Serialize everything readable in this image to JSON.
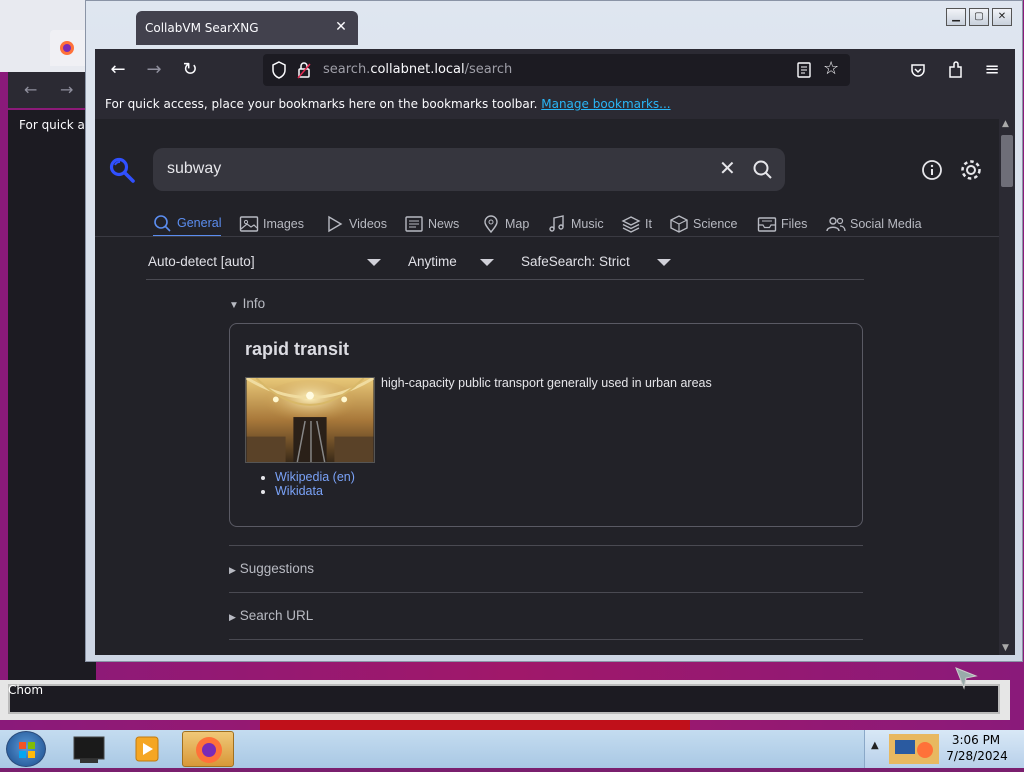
{
  "background_window": {
    "bookmark_hint": "For quick ac",
    "taskbar_label": "Chom"
  },
  "window": {
    "tab_title": "CollabVM SearXNG",
    "tab_close": "✕",
    "url_domain_prefix": "search.",
    "url_domain": "collabnet.local",
    "url_path": "/search",
    "bookmarks_text": "For quick access, place your bookmarks here on the bookmarks toolbar.",
    "bookmarks_link": "Manage bookmarks..."
  },
  "search": {
    "query": "subway"
  },
  "categories": [
    {
      "label": "General",
      "icon": "search-icon",
      "active": true
    },
    {
      "label": "Images",
      "icon": "image-icon"
    },
    {
      "label": "Videos",
      "icon": "play-icon"
    },
    {
      "label": "News",
      "icon": "newspaper-icon"
    },
    {
      "label": "Map",
      "icon": "map-pin-icon"
    },
    {
      "label": "Music",
      "icon": "music-icon"
    },
    {
      "label": "It",
      "icon": "layers-icon"
    },
    {
      "label": "Science",
      "icon": "cube-icon"
    },
    {
      "label": "Files",
      "icon": "inbox-icon"
    },
    {
      "label": "Social Media",
      "icon": "people-icon"
    }
  ],
  "filters": {
    "language": "Auto-detect [auto]",
    "time": "Anytime",
    "safesearch": "SafeSearch: Strict"
  },
  "info": {
    "section_label": "Info",
    "title": "rapid transit",
    "description": "high-capacity public transport generally used in urban areas",
    "links": [
      "Wikipedia (en)",
      "Wikidata"
    ]
  },
  "sections": {
    "suggestions": "Suggestions",
    "search_url": "Search URL"
  },
  "taskbar": {
    "time": "3:06 PM",
    "date": "7/28/2024"
  },
  "colors": {
    "accent": "#5b8def",
    "link": "#7aa2f7",
    "content_bg": "#222228"
  }
}
